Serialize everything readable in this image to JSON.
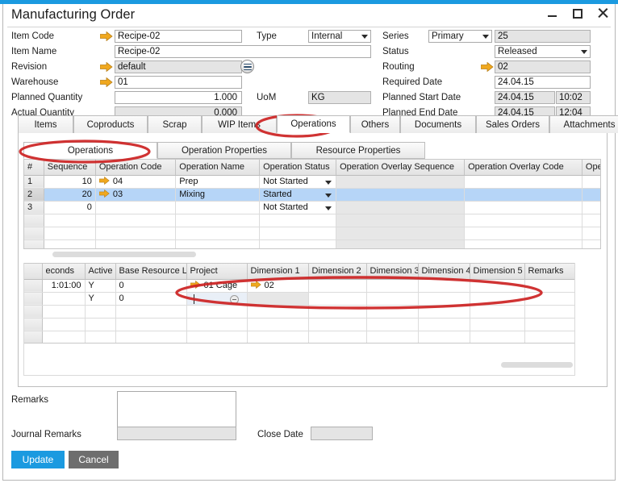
{
  "window": {
    "title": "Manufacturing Order",
    "controls": [
      {
        "name": "minimize",
        "glyph": "_"
      },
      {
        "name": "maximize",
        "glyph": "□"
      },
      {
        "name": "close",
        "glyph": "✕"
      }
    ]
  },
  "header": {
    "left_fields": [
      {
        "label": "Item Code",
        "value": "Recipe-02",
        "arrow": true,
        "readonly": false
      },
      {
        "label": "Item Name",
        "value": "Recipe-02",
        "arrow": false,
        "readonly": false
      },
      {
        "label": "Revision",
        "value": "default",
        "arrow": true,
        "readonly": true
      },
      {
        "label": "Warehouse",
        "value": "01",
        "arrow": true,
        "readonly": false
      },
      {
        "label": "Planned Quantity",
        "value": "1.000",
        "arrow": false,
        "readonly": false
      },
      {
        "label": "Actual Quantity",
        "value": "0.000",
        "arrow": false,
        "readonly": true
      }
    ],
    "type_label": "Type",
    "type_value": "Internal",
    "uom_label": "UoM",
    "uom_value": "KG",
    "right_fields": [
      {
        "label": "Series",
        "value": "Primary",
        "extra": "25"
      },
      {
        "label": "Status",
        "value": "Released"
      },
      {
        "label": "Routing",
        "value": "02",
        "arrow": true
      },
      {
        "label": "Required Date",
        "value": "24.04.15"
      },
      {
        "label": "Planned Start Date",
        "value": "24.04.15",
        "time": "10:02"
      },
      {
        "label": "Planned End Date",
        "value": "24.04.15",
        "time": "12:04"
      }
    ]
  },
  "tabs": [
    {
      "label": "Items",
      "active": false
    },
    {
      "label": "Coproducts",
      "active": false
    },
    {
      "label": "Scrap",
      "active": false
    },
    {
      "label": "WIP Items",
      "active": false
    },
    {
      "label": "Operations",
      "active": true
    },
    {
      "label": "Others",
      "active": false
    },
    {
      "label": "Documents",
      "active": false
    },
    {
      "label": "Sales Orders",
      "active": false
    },
    {
      "label": "Attachments",
      "active": false
    }
  ],
  "subtabs": [
    {
      "label": "Operations",
      "active": true
    },
    {
      "label": "Operation Properties",
      "active": false
    },
    {
      "label": "Resource Properties",
      "active": false
    }
  ],
  "operations_grid": {
    "columns": [
      "#",
      "Sequence",
      "Operation Code",
      "Operation Name",
      "Operation Status",
      "Operation Overlay Sequence",
      "Operation Overlay Code",
      "Oper..."
    ],
    "rows": [
      {
        "num": "1",
        "sequence": "10",
        "code": "04",
        "code_arrow": true,
        "name": "Prep",
        "status": "Not Started",
        "overlay_sequence": "",
        "overlay_code": "",
        "oper": "",
        "selected": false
      },
      {
        "num": "2",
        "sequence": "20",
        "code": "03",
        "code_arrow": true,
        "name": "Mixing",
        "status": "Started",
        "overlay_sequence": "",
        "overlay_code": "",
        "oper": "",
        "selected": true
      },
      {
        "num": "3",
        "sequence": "0",
        "code": "",
        "code_arrow": false,
        "name": "",
        "status": "Not Started",
        "overlay_sequence": "",
        "overlay_code": "",
        "oper": "",
        "selected": false
      },
      {
        "num": "",
        "sequence": "",
        "code": "",
        "code_arrow": false,
        "name": "",
        "status": "",
        "overlay_sequence": "",
        "overlay_code": "",
        "oper": "",
        "selected": false
      },
      {
        "num": "",
        "sequence": "",
        "code": "",
        "code_arrow": false,
        "name": "",
        "status": "",
        "overlay_sequence": "",
        "overlay_code": "",
        "oper": "",
        "selected": false
      },
      {
        "num": "",
        "sequence": "",
        "code": "",
        "code_arrow": false,
        "name": "",
        "status": "",
        "overlay_sequence": "",
        "overlay_code": "",
        "oper": "",
        "selected": false
      }
    ]
  },
  "resources_grid": {
    "columns": [
      "",
      "econds",
      "Active",
      "Base Resource Line",
      "Project",
      "Dimension 1",
      "Dimension 2",
      "Dimension 3",
      "Dimension 4",
      "Dimension 5",
      "Remarks"
    ],
    "rows": [
      {
        "num": "",
        "seconds": "1:01:00",
        "active": "Y",
        "base_resource_line": "0",
        "project": "01 Cage",
        "project_arrow": true,
        "dim1": "02",
        "dim1_arrow": true,
        "dim2": "",
        "dim3": "",
        "dim4": "",
        "dim5": "",
        "remarks": "",
        "focused": false
      },
      {
        "num": "",
        "seconds": "",
        "active": "Y",
        "base_resource_line": "0",
        "project": "",
        "project_arrow": false,
        "dim1": "",
        "dim1_arrow": false,
        "dim2": "",
        "dim3": "",
        "dim4": "",
        "dim5": "",
        "remarks": "",
        "focused": true
      },
      {
        "num": "",
        "seconds": "",
        "active": "",
        "base_resource_line": "",
        "project": "",
        "project_arrow": false,
        "dim1": "",
        "dim1_arrow": false,
        "dim2": "",
        "dim3": "",
        "dim4": "",
        "dim5": "",
        "remarks": "",
        "focused": false
      },
      {
        "num": "",
        "seconds": "",
        "active": "",
        "base_resource_line": "",
        "project": "",
        "project_arrow": false,
        "dim1": "",
        "dim1_arrow": false,
        "dim2": "",
        "dim3": "",
        "dim4": "",
        "dim5": "",
        "remarks": "",
        "focused": false
      },
      {
        "num": "",
        "seconds": "",
        "active": "",
        "base_resource_line": "",
        "project": "",
        "project_arrow": false,
        "dim1": "",
        "dim1_arrow": false,
        "dim2": "",
        "dim3": "",
        "dim4": "",
        "dim5": "",
        "remarks": "",
        "focused": false
      }
    ]
  },
  "footer": {
    "remarks_label": "Remarks",
    "remarks_value": "",
    "journal_remarks_label": "Journal Remarks",
    "journal_remarks_value": "",
    "close_date_label": "Close Date",
    "close_date_value": "",
    "update_button": "Update",
    "cancel_button": "Cancel"
  },
  "colors": {
    "accent": "#1b9ae0",
    "selection": "#b6d5f7",
    "annotation": "#cc2222",
    "arrow": "#f0a81e",
    "button_secondary": "#6e6e6e"
  }
}
